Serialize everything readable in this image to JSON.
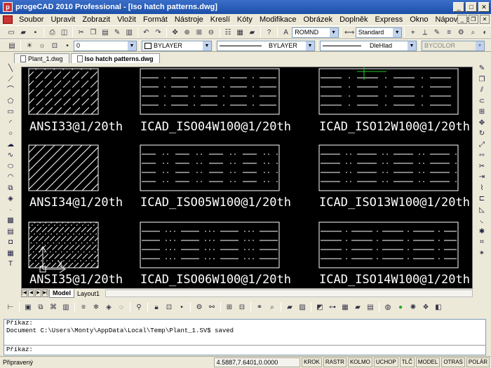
{
  "window": {
    "title": "progeCAD 2010 Professional - [Iso hatch patterns.dwg]"
  },
  "menu": [
    "Soubor",
    "Upravit",
    "Zobrazit",
    "Vložit",
    "Formát",
    "Nástroje",
    "Kreslí",
    "Kóty",
    "Modifikace",
    "Obrázek",
    "Doplněk",
    "Express",
    "Okno",
    "Nápověda"
  ],
  "toolbar": {
    "text_style": "ROMND",
    "dim_style": "Standard",
    "layer": "0",
    "color": "BYLAYER",
    "linetype": "BYLAYER",
    "lineweight": "DleHlad",
    "plotstyle": "BYCOLOR"
  },
  "doc_tabs": [
    "Plant_1.dwg",
    "Iso hatch patterns.dwg"
  ],
  "drawing": {
    "labels": [
      "ANSI33@1/20th",
      "ICAD_ISO04W100@1/20th",
      "ICAD_ISO12W100@1/20th",
      "ANSI34@1/20th",
      "ICAD_ISO05W100@1/20th",
      "ICAD_ISO13W100@1/20th",
      "ANSI35@1/20th",
      "ICAD_ISO06W100@1/20th",
      "ICAD_ISO14W100@1/20th"
    ]
  },
  "layout_tabs": [
    "Model",
    "Layout1"
  ],
  "command": {
    "line1": "Příkaz:",
    "line2": "Document C:\\Users\\Monty\\AppData\\Local\\Temp\\Plant_1.SV$ saved",
    "prompt": "Příkaz:"
  },
  "status": {
    "ready": "Připravený",
    "coords": "4.5887,7.6401,0.0000",
    "buttons": [
      "KROK",
      "RASTR",
      "KOLMO",
      "UCHOP",
      "TLČ",
      "MODEL",
      "OTRAS",
      "POLÁR"
    ]
  }
}
